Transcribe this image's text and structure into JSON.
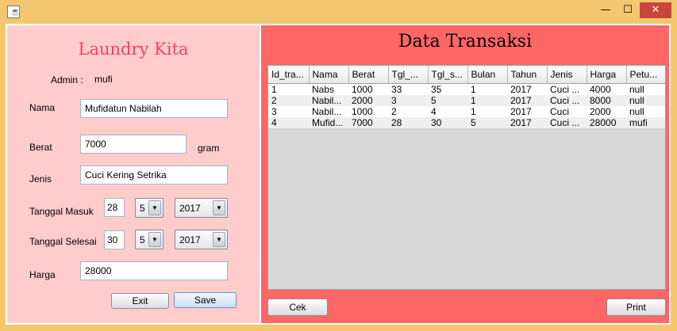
{
  "window": {
    "icon": "java-icon",
    "minimize": "—",
    "maximize": "☐",
    "close": "✕"
  },
  "form": {
    "title": "Laundry Kita",
    "admin_label": "Admin :",
    "admin_value": "mufi",
    "nama_label": "Nama",
    "nama_value": "Mufidatun Nabilah",
    "berat_label": "Berat",
    "berat_value": "7000",
    "berat_unit": "gram",
    "jenis_label": "Jenis",
    "jenis_value": "Cuci Kering Setrika",
    "tgl_masuk_label": "Tanggal Masuk",
    "tgl_masuk_day": "28",
    "tgl_masuk_month": "5",
    "tgl_masuk_year": "2017",
    "tgl_selesai_label": "Tanggal Selesai",
    "tgl_selesai_day": "30",
    "tgl_selesai_month": "5",
    "tgl_selesai_year": "2017",
    "harga_label": "Harga",
    "harga_value": "28000",
    "exit_label": "Exit",
    "save_label": "Save"
  },
  "data": {
    "title": "Data Transaksi",
    "columns": [
      "Id_tra...",
      "Nama",
      "Berat",
      "Tgl_...",
      "Tgl_s...",
      "Bulan",
      "Tahun",
      "Jenis",
      "Harga",
      "Petu..."
    ],
    "rows": [
      [
        "1",
        "Nabs",
        "1000",
        "33",
        "35",
        "1",
        "2017",
        "Cuci ...",
        "4000",
        "null"
      ],
      [
        "2",
        "Nabil...",
        "2000",
        "3",
        "5",
        "1",
        "2017",
        "Cuci ...",
        "8000",
        "null"
      ],
      [
        "3",
        "Nabil...",
        "1000",
        "2",
        "4",
        "1",
        "2017",
        "Cuci",
        "2000",
        "null"
      ],
      [
        "4",
        "Mufid...",
        "7000",
        "28",
        "30",
        "5",
        "2017",
        "Cuci ...",
        "28000",
        "mufi"
      ]
    ],
    "cek_label": "Cek",
    "print_label": "Print"
  },
  "colors": {
    "left_panel": "#ffcccc",
    "right_panel": "#ff6666",
    "title_accent": "#ee4466",
    "window_frame": "#f5c76b"
  }
}
